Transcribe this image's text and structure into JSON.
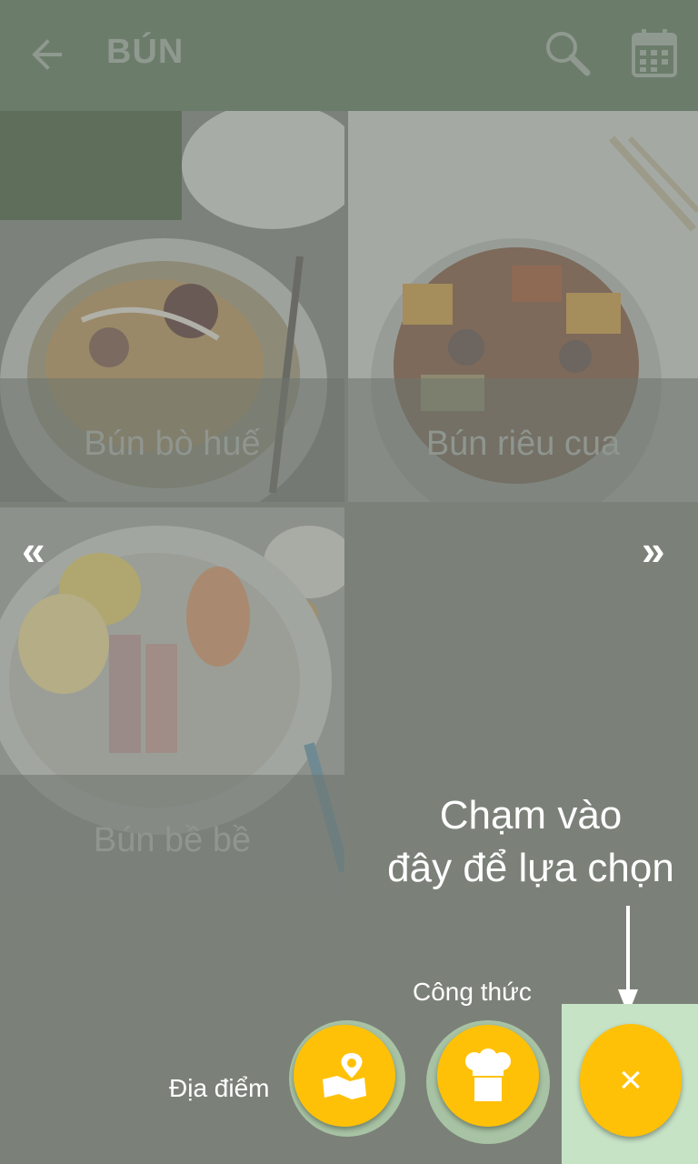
{
  "appbar": {
    "title": "BÚN",
    "back_icon": "arrow-left-icon",
    "search_icon": "search-icon",
    "calendar_icon": "calendar-icon"
  },
  "dishes": [
    {
      "name": "Bún bò huế"
    },
    {
      "name": "Bún riêu cua"
    },
    {
      "name": "Bún bề bề"
    }
  ],
  "pager": {
    "prev_glyph": "«",
    "next_glyph": "»"
  },
  "tutorial": {
    "hint_line1": "Chạm vào",
    "hint_line2": "đây để lựa chọn"
  },
  "fab_menu": {
    "location_label": "Địa điểm",
    "recipe_label": "Công thức",
    "close_glyph": "×"
  },
  "colors": {
    "overlay": "#7b8179",
    "appbar": "#6b7c6b",
    "fab": "#ffc107",
    "highlight": "#c6e3c6"
  }
}
